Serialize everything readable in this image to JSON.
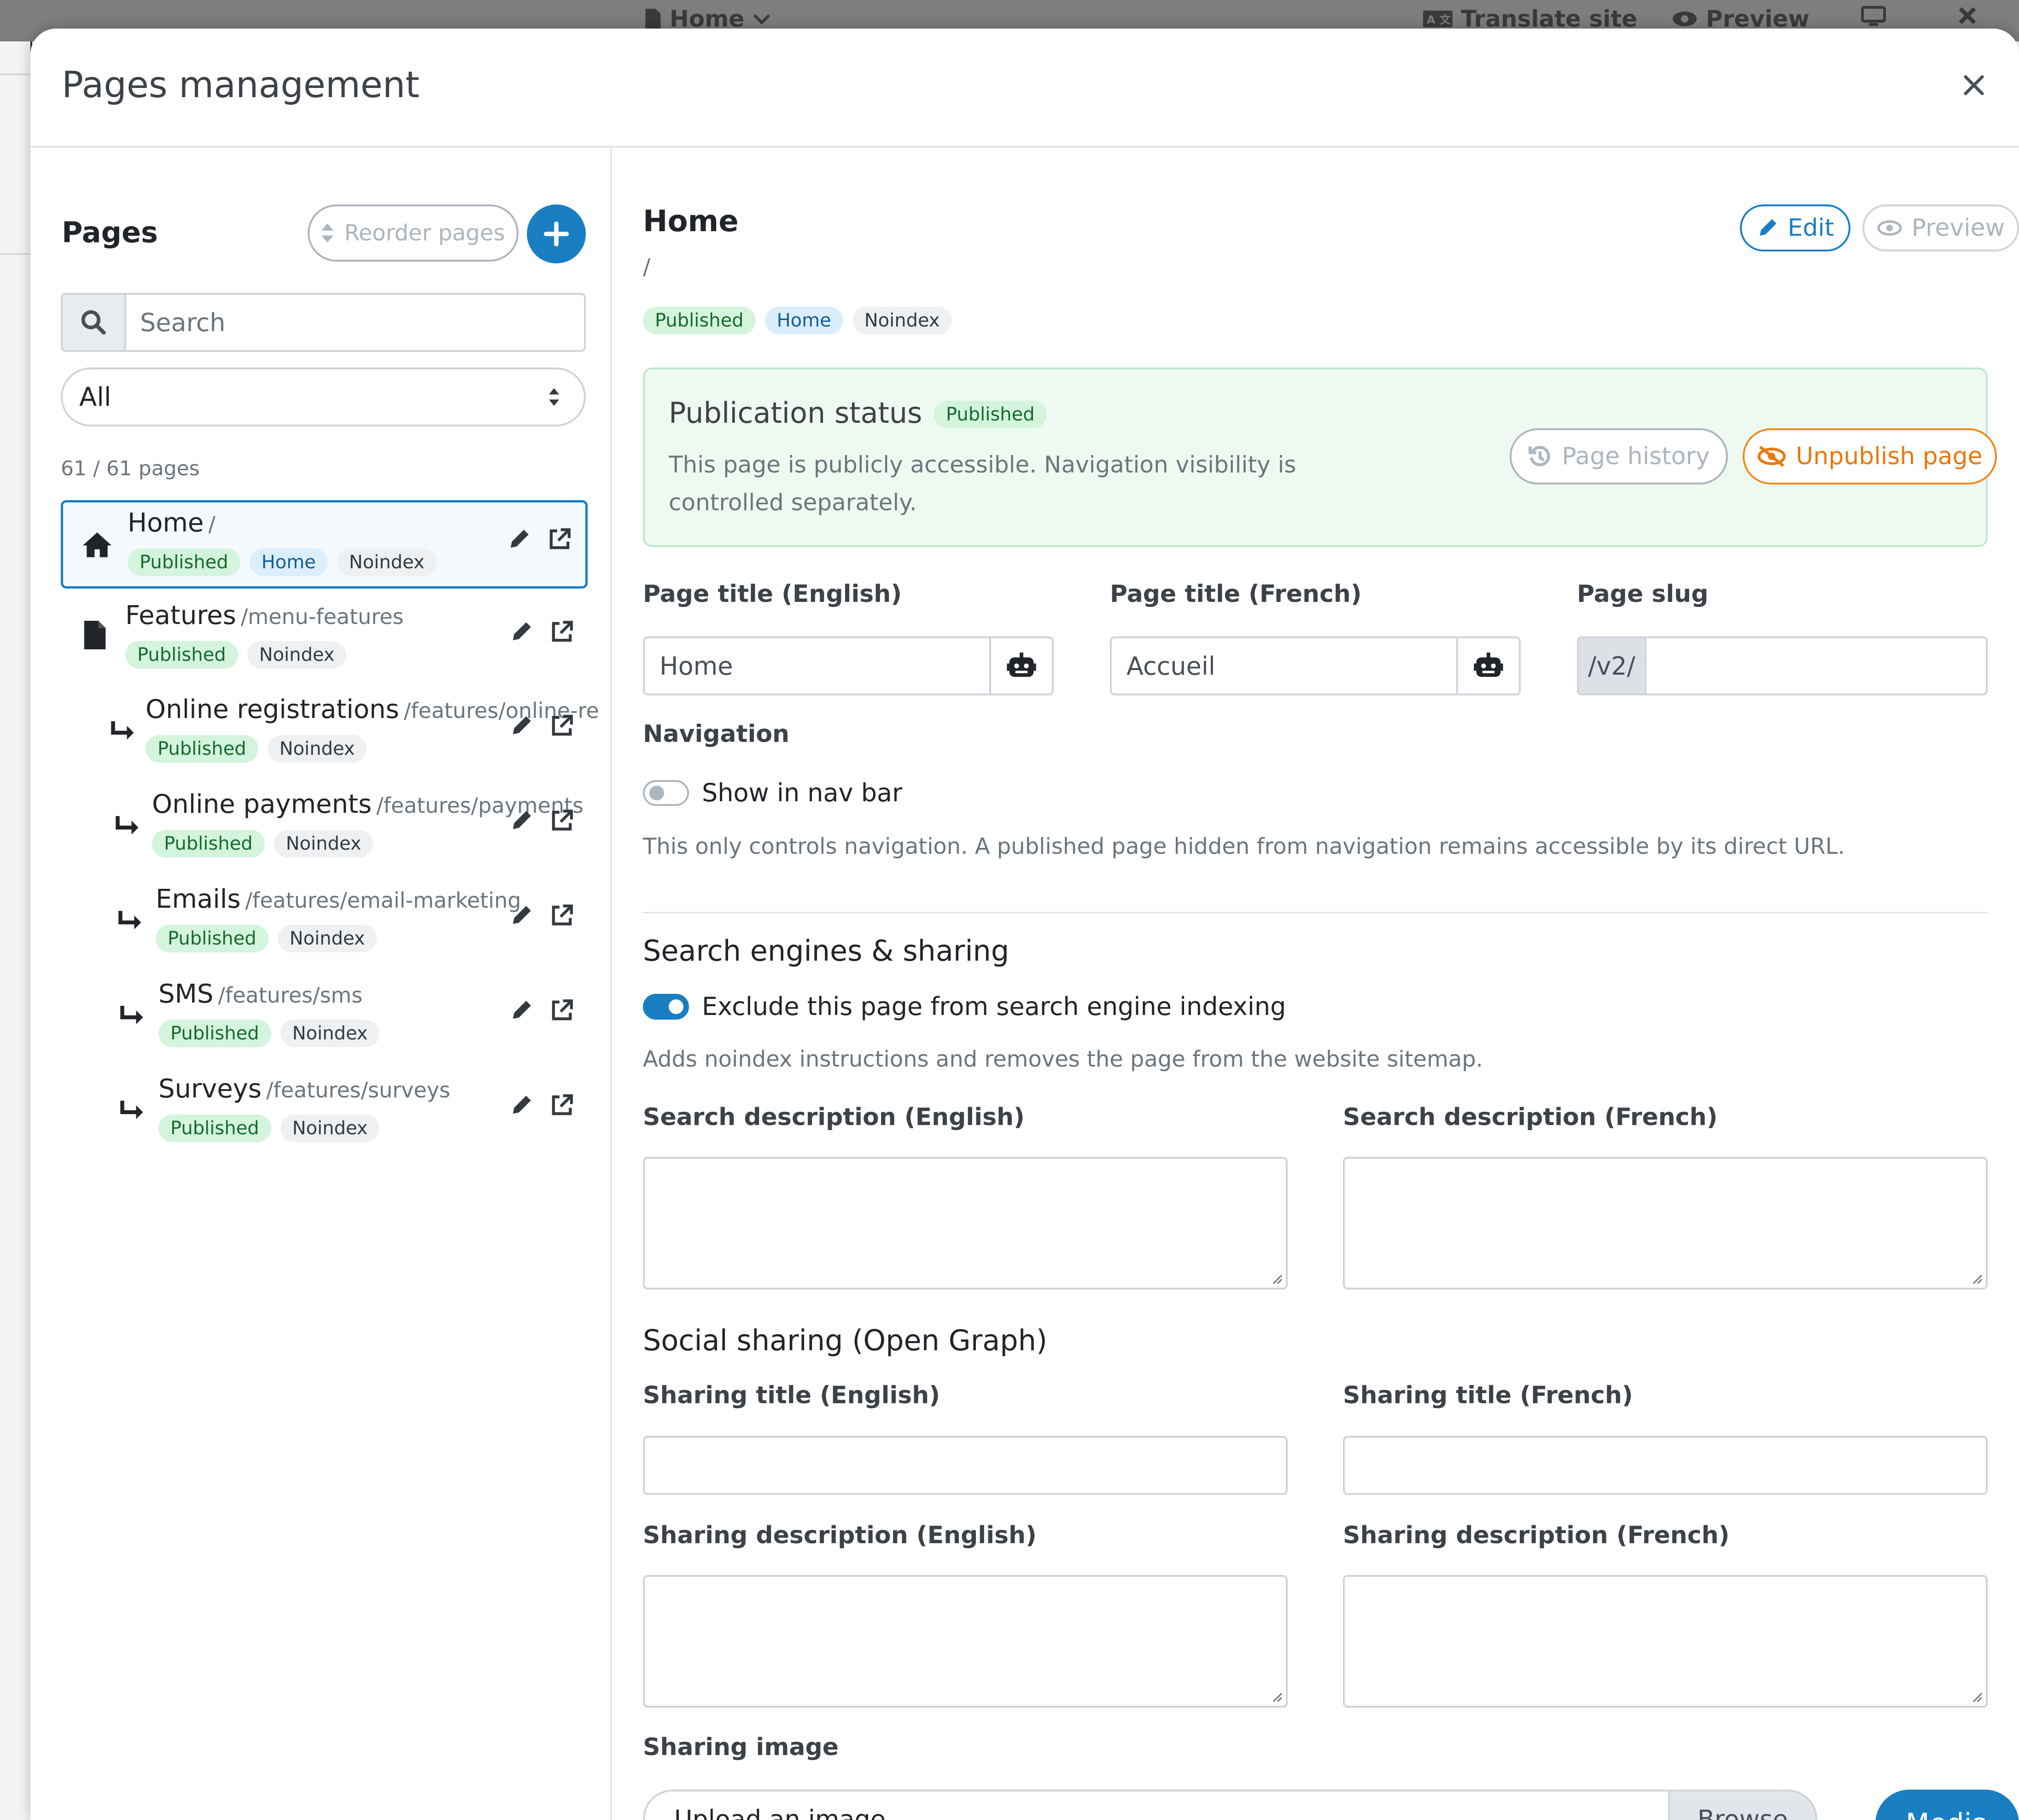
{
  "background": {
    "topbar": {
      "home_label": "Home",
      "translate_label": "Translate site",
      "preview_label": "Preview"
    }
  },
  "modal": {
    "title": "Pages management"
  },
  "sidebar": {
    "heading": "Pages",
    "reorder_label": "Reorder pages",
    "search_placeholder": "Search",
    "filter_value": "All",
    "count_text": "61 / 61 pages",
    "pages": [
      {
        "name": "Home",
        "slug": "/",
        "icon": "house-icon",
        "badges": [
          "Published",
          "Home",
          "Noindex"
        ],
        "active": true,
        "level": 0
      },
      {
        "name": "Features",
        "slug": "/menu-features",
        "icon": "file-icon",
        "badges": [
          "Published",
          "Noindex"
        ],
        "active": false,
        "level": 0
      },
      {
        "name": "Online registrations",
        "slug": "/features/online-re",
        "icon": "child-arrow-icon",
        "badges": [
          "Published",
          "Noindex"
        ],
        "active": false,
        "level": 1
      },
      {
        "name": "Online payments",
        "slug": "/features/payments",
        "icon": "child-arrow-icon",
        "badges": [
          "Published",
          "Noindex"
        ],
        "active": false,
        "level": 1
      },
      {
        "name": "Emails",
        "slug": "/features/email-marketing",
        "icon": "child-arrow-icon",
        "badges": [
          "Published",
          "Noindex"
        ],
        "active": false,
        "level": 1
      },
      {
        "name": "SMS",
        "slug": "/features/sms",
        "icon": "child-arrow-icon",
        "badges": [
          "Published",
          "Noindex"
        ],
        "active": false,
        "level": 1
      },
      {
        "name": "Surveys",
        "slug": "/features/surveys",
        "icon": "child-arrow-icon",
        "badges": [
          "Published",
          "Noindex"
        ],
        "active": false,
        "level": 1
      }
    ]
  },
  "detail": {
    "title": "Home",
    "slug": "/",
    "badges": [
      "Published",
      "Home",
      "Noindex"
    ],
    "edit_label": "Edit",
    "preview_label": "Preview",
    "publication": {
      "title": "Publication status",
      "badge": "Published",
      "description": "This page is publicly accessible. Navigation visibility is controlled separately.",
      "history_label": "Page history",
      "unpublish_label": "Unpublish page"
    },
    "fields": {
      "title_en_label": "Page title (English)",
      "title_en_value": "Home",
      "title_fr_label": "Page title (French)",
      "title_fr_value": "Accueil",
      "slug_label": "Page slug",
      "slug_prefix": "/v2/",
      "slug_value": ""
    },
    "navigation": {
      "label": "Navigation",
      "toggle_label": "Show in nav bar",
      "toggle_on": false,
      "help": "This only controls navigation. A published page hidden from navigation remains accessible by its direct URL."
    },
    "seo": {
      "title": "Search engines & sharing",
      "noindex_label": "Exclude this page from search engine indexing",
      "noindex_on": true,
      "help": "Adds noindex instructions and removes the page from the website sitemap.",
      "desc_en_label": "Search description (English)",
      "desc_fr_label": "Search description (French)"
    },
    "social": {
      "title": "Social sharing (Open Graph)",
      "title_en_label": "Sharing title (English)",
      "title_fr_label": "Sharing title (French)",
      "desc_en_label": "Sharing description (English)",
      "desc_fr_label": "Sharing description (French)",
      "image_label": "Sharing image",
      "upload_label": "Upload an image",
      "browse_label": "Browse",
      "media_label": "Media"
    }
  },
  "colors": {
    "primary": "#1a7ec2",
    "success_bg": "#d4f4dd",
    "warning": "#e8790a"
  }
}
